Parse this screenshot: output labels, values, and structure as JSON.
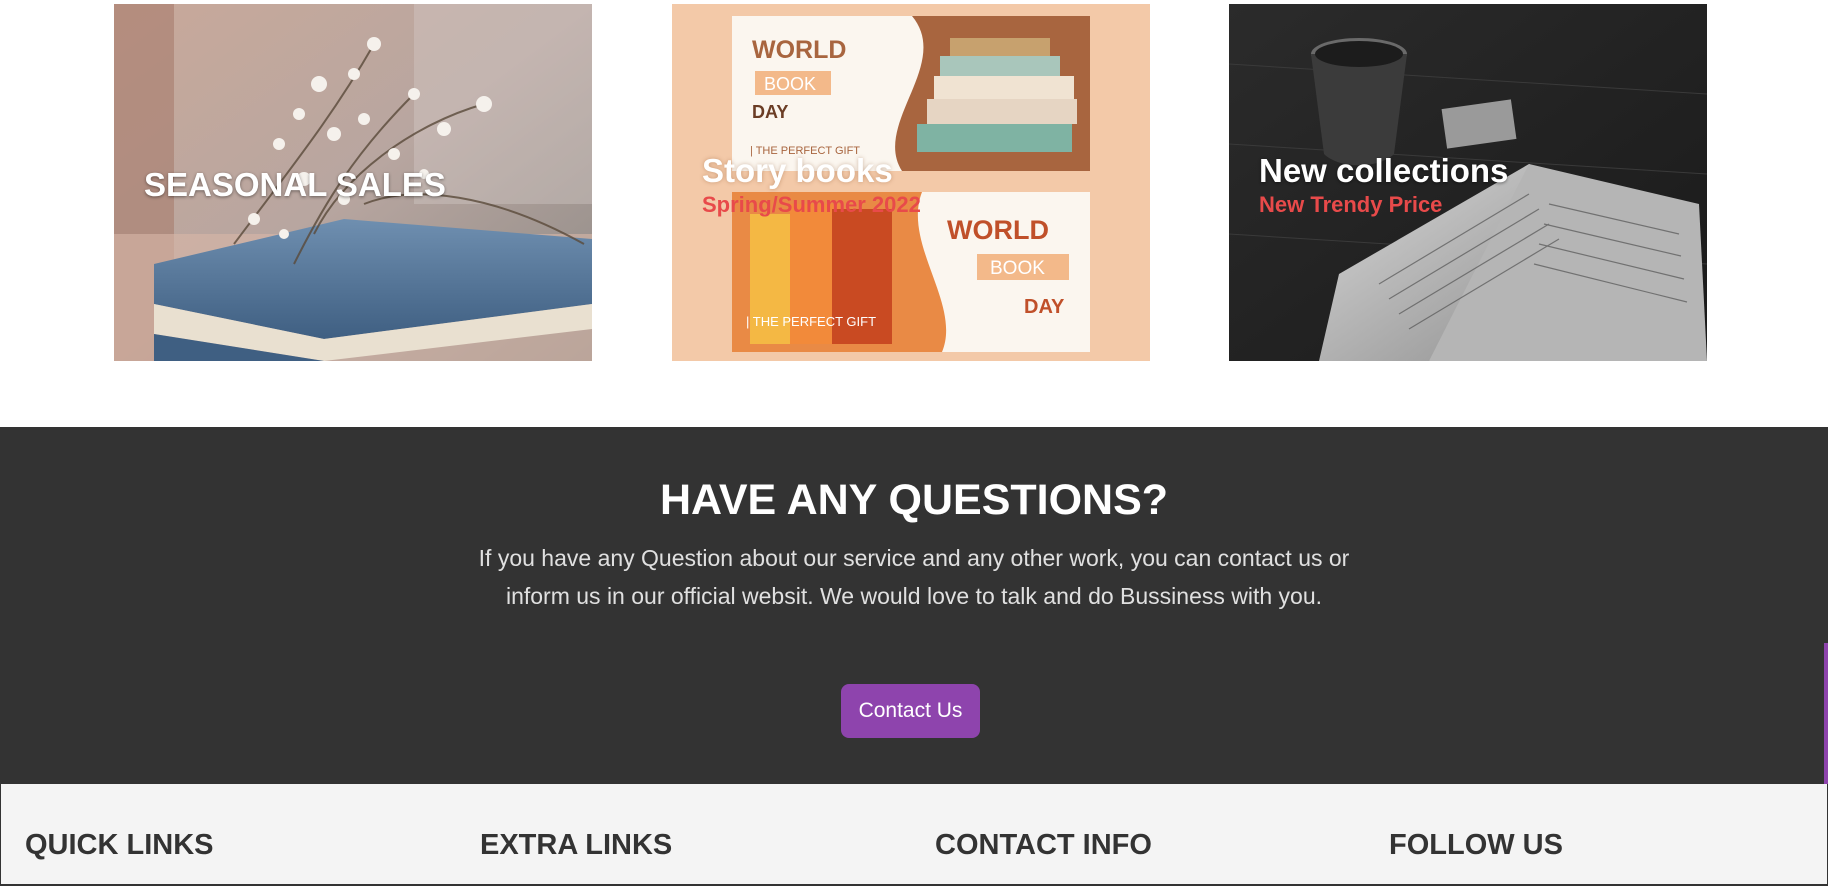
{
  "banners": [
    {
      "title": "SEASONAL SALES",
      "subtitle": ""
    },
    {
      "title": "Story books",
      "subtitle": "Spring/Summer 2022",
      "poster": {
        "top": [
          "WORLD",
          "BOOK",
          "DAY",
          "| THE PERFECT GIFT"
        ],
        "bottom": [
          "WORLD",
          "BOOK",
          "DAY",
          "| THE PERFECT GIFT"
        ]
      }
    },
    {
      "title": "New collections",
      "subtitle": "New Trendy Price"
    }
  ],
  "questions": {
    "title": "HAVE ANY QUESTIONS?",
    "text": "If you have any Question about our service and any other work, you can contact us or inform us in our official websit. We would love to talk and do Bussiness with you.",
    "button_label": "Contact Us"
  },
  "footer": {
    "headings": [
      "QUICK LINKS",
      "EXTRA LINKS",
      "CONTACT INFO",
      "FOLLOW US"
    ]
  },
  "colors": {
    "accent": "#8e44ad",
    "subtitle_red": "#e84a4a",
    "dark_section": "#333333",
    "footer_bg": "#f4f4f4"
  }
}
